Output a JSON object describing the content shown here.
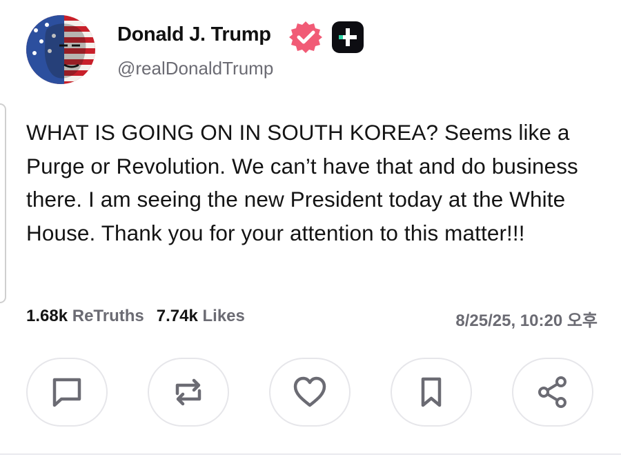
{
  "colors": {
    "verified_badge": "#f15b76",
    "plus_badge_bg": "#0d0d12",
    "plus_badge_accent": "#2fd5a6",
    "secondary_text": "#6b6b73",
    "icon_stroke": "#6b6b73"
  },
  "author": {
    "display_name": "Donald J. Trump",
    "handle": "@realDonaldTrump",
    "verified_icon": "verified-badge-icon",
    "plus_icon": "truth-plus-icon"
  },
  "post": {
    "text": "WHAT IS GOING ON IN SOUTH KOREA? Seems like a Purge or Revolution. We can’t have that and do business there. I am seeing the new President today at the White House. Thank you for your attention to this matter!!!"
  },
  "stats": {
    "retruths_count": "1.68k",
    "retruths_label": "ReTruths",
    "likes_count": "7.74k",
    "likes_label": "Likes",
    "timestamp": "8/25/25, 10:20 오후"
  },
  "actions": [
    {
      "name": "reply",
      "icon": "comment-icon"
    },
    {
      "name": "retruth",
      "icon": "repost-icon"
    },
    {
      "name": "like",
      "icon": "heart-icon"
    },
    {
      "name": "bookmark",
      "icon": "bookmark-icon"
    },
    {
      "name": "share",
      "icon": "share-icon"
    }
  ]
}
